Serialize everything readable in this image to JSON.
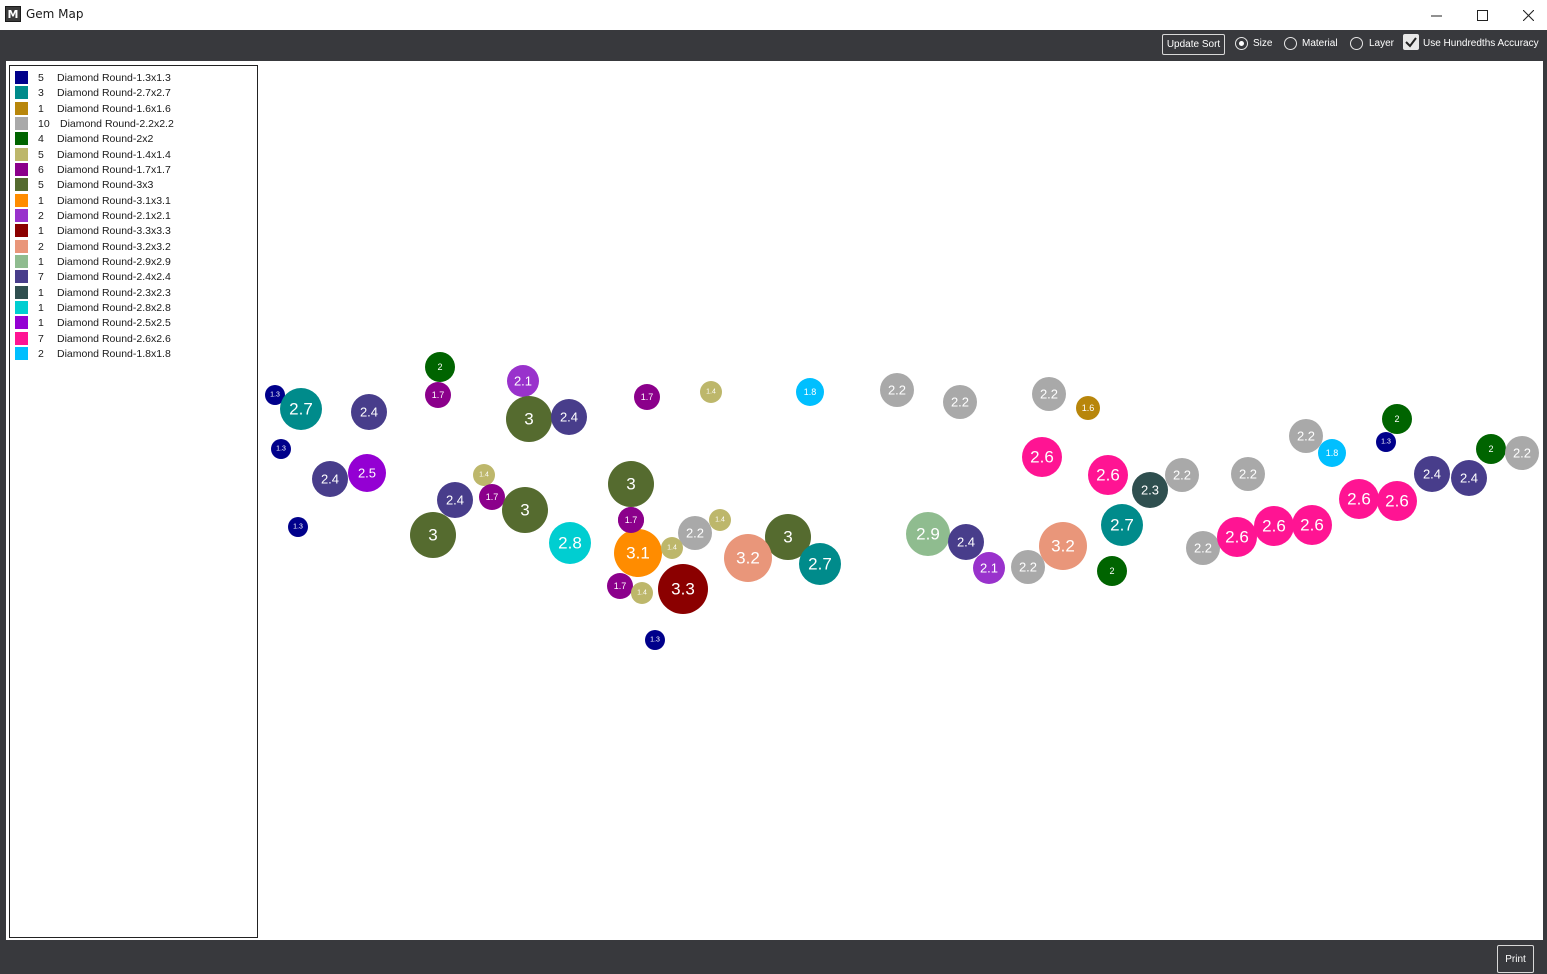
{
  "window": {
    "title": "Gem Map",
    "logo_letter": "M"
  },
  "toolbar": {
    "update_sort_label": "Update Sort",
    "sort_options": [
      {
        "label": "Size",
        "selected": true
      },
      {
        "label": "Material",
        "selected": false
      },
      {
        "label": "Layer",
        "selected": false
      }
    ],
    "accuracy_label": "Use Hundredths Accuracy",
    "accuracy_checked": true
  },
  "legend": [
    {
      "color": "#00008b",
      "count": "5",
      "name": "Diamond Round-1.3x1.3"
    },
    {
      "color": "#008b8b",
      "count": "3",
      "name": "Diamond Round-2.7x2.7"
    },
    {
      "color": "#b8860b",
      "count": "1",
      "name": "Diamond Round-1.6x1.6"
    },
    {
      "color": "#a9a9a9",
      "count": "10",
      "name": "Diamond Round-2.2x2.2"
    },
    {
      "color": "#006400",
      "count": "4",
      "name": "Diamond Round-2x2"
    },
    {
      "color": "#bdb76b",
      "count": "5",
      "name": "Diamond Round-1.4x1.4"
    },
    {
      "color": "#8b008b",
      "count": "6",
      "name": "Diamond Round-1.7x1.7"
    },
    {
      "color": "#556b2f",
      "count": "5",
      "name": "Diamond Round-3x3"
    },
    {
      "color": "#ff8c00",
      "count": "1",
      "name": "Diamond Round-3.1x3.1"
    },
    {
      "color": "#9932cc",
      "count": "2",
      "name": "Diamond Round-2.1x2.1"
    },
    {
      "color": "#8b0000",
      "count": "1",
      "name": "Diamond Round-3.3x3.3"
    },
    {
      "color": "#e9967a",
      "count": "2",
      "name": "Diamond Round-3.2x3.2"
    },
    {
      "color": "#8fbc8f",
      "count": "1",
      "name": "Diamond Round-2.9x2.9"
    },
    {
      "color": "#483d8b",
      "count": "7",
      "name": "Diamond Round-2.4x2.4"
    },
    {
      "color": "#2f4f4f",
      "count": "1",
      "name": "Diamond Round-2.3x2.3"
    },
    {
      "color": "#00ced1",
      "count": "1",
      "name": "Diamond Round-2.8x2.8"
    },
    {
      "color": "#9400d3",
      "count": "1",
      "name": "Diamond Round-2.5x2.5"
    },
    {
      "color": "#ff1493",
      "count": "7",
      "name": "Diamond Round-2.6x2.6"
    },
    {
      "color": "#00bfff",
      "count": "2",
      "name": "Diamond Round-1.8x1.8"
    }
  ],
  "gems": [
    "1.3",
    "2.7",
    "2.4",
    "2",
    "1.7",
    "2.1",
    "3",
    "2.4",
    "1.7",
    "1.4",
    "1.8",
    "2.2",
    "2.2",
    "2.2",
    "1.6",
    "2.6",
    "2.6",
    "2.3",
    "2.2",
    "2.2",
    "2.2",
    "1.8",
    "1.3",
    "2",
    "2",
    "2.2",
    "2.4",
    "2.4",
    "1.3",
    "2.4",
    "2.5",
    "1.4",
    "1.7",
    "2.4",
    "3",
    "3",
    "1.7",
    "1.3",
    "3",
    "1.7",
    "1.4",
    "2.2",
    "3",
    "2.8",
    "3.1",
    "1.4",
    "3.2",
    "2.7",
    "1.7",
    "1.4",
    "3.3",
    "1.3",
    "2.9",
    "2.4",
    "2.1",
    "2.2",
    "3.2",
    "2.7",
    "2",
    "2.2",
    "2.6",
    "2.6",
    "2.6",
    "2.6",
    "2.6"
  ],
  "footer": {
    "print_label": "Print"
  }
}
